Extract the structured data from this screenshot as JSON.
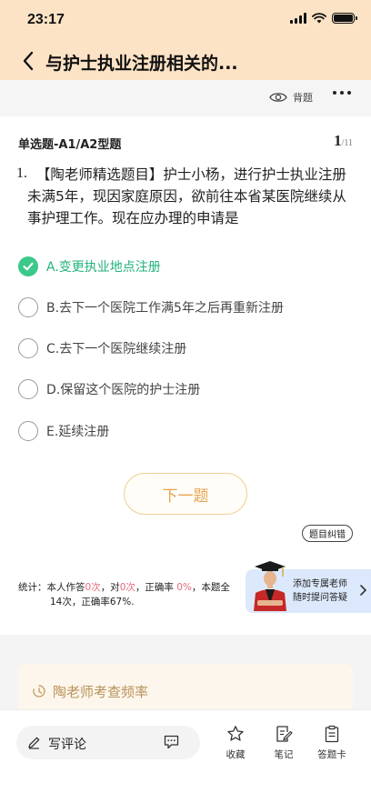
{
  "status_bar": {
    "time": "23:17"
  },
  "header": {
    "title": "与护士执业注册相关的..."
  },
  "toolbar": {
    "recite_label": "背题"
  },
  "question": {
    "type": "单选题-A1/A2型题",
    "current": "1",
    "total": "/11",
    "number": "1.",
    "text": "【陶老师精选题目】护士小杨，进行护士执业注册未满5年，现因家庭原因，欲前往本省某医院继续从事护理工作。现在应办理的申请是",
    "options": [
      {
        "label": "A.变更执业地点注册",
        "selected": true
      },
      {
        "label": "B.去下一个医院工作满5年之后再重新注册",
        "selected": false
      },
      {
        "label": "C.去下一个医院继续注册",
        "selected": false
      },
      {
        "label": "D.保留这个医院的护士注册",
        "selected": false
      },
      {
        "label": "E.延续注册",
        "selected": false
      }
    ]
  },
  "actions": {
    "next_label": "下一题",
    "report_label": "题目纠错"
  },
  "stats": {
    "prefix": "统计：本人作答",
    "answered": "0次",
    "sep1": "，对",
    "correct": "0次",
    "sep2": "，正确率 ",
    "rate": "0%",
    "sep3": "，本题全",
    "line2": "14次，正确率67%."
  },
  "teacher_banner": {
    "line1": "添加专属老师",
    "line2": "随时提问答疑"
  },
  "frequency": {
    "title": "陶老师考查频率"
  },
  "bottom_bar": {
    "comment_label": "写评论",
    "favorite_label": "收藏",
    "note_label": "笔记",
    "answer_card_label": "答题卡"
  },
  "colors": {
    "header_bg": "#fde3c6",
    "correct_green": "#3cc88a",
    "accent_orange": "#e8a44f",
    "stat_pink": "#e36c7b"
  }
}
